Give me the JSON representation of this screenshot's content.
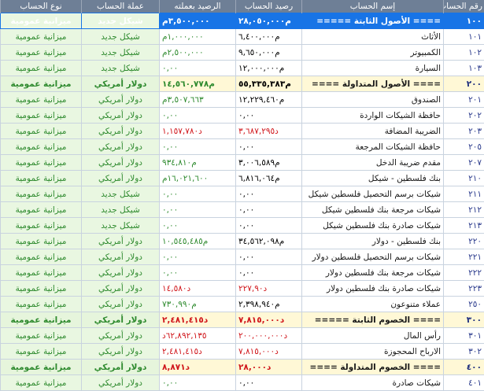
{
  "headers": {
    "code": "رقم الحساب",
    "name": "إسم الحساب",
    "balance": "رصيد الحساب",
    "balance_cur": "الرصيد بعملته",
    "currency": "عملة الحساب",
    "type": "نوع الحساب"
  },
  "rows": [
    {
      "code": "١٠٠",
      "name": "==== الأصول الثابتة =====",
      "balance": "م٢٨,٠٥٠,٠٠٠",
      "balance_cur": "٣,٥٠٠,٠٠٠م",
      "currency": "شيكل جديد",
      "type": "ميزانية عمومية",
      "style": "sel",
      "bal_color": "",
      "cur_color": ""
    },
    {
      "code": "١٠١",
      "name": "الأثاث",
      "balance": "م٦,٤٠٠,٠٠٠",
      "balance_cur": "١,٠٠٠,٠٠٠م",
      "currency": "شيكل جديد",
      "type": "ميزانية عمومية",
      "style": "",
      "bal_color": "",
      "cur_color": "pos"
    },
    {
      "code": "١٠٢",
      "name": "الكمبيوتر",
      "balance": "م٩,٦٥٠,٠٠٠",
      "balance_cur": "٢,٥٠٠,٠٠٠م",
      "currency": "شيكل جديد",
      "type": "ميزانية عمومية",
      "style": "",
      "bal_color": "",
      "cur_color": "pos"
    },
    {
      "code": "١٠٣",
      "name": "السيارة",
      "balance": "م١٢,٠٠٠,٠٠٠",
      "balance_cur": "٠,٠٠",
      "currency": "شيكل جديد",
      "type": "ميزانية عمومية",
      "style": "",
      "bal_color": "",
      "cur_color": "pos"
    },
    {
      "code": "٢٠٠",
      "name": "==== الأصول المتداولة ====",
      "balance": "م٥٥,٣٣٥,٣٨٣",
      "balance_cur": "م١٤,٥٦٠,٧٧٨",
      "currency": "دولار أمريكي",
      "type": "ميزانية عمومية",
      "style": "grp",
      "bal_color": "",
      "cur_color": "pos"
    },
    {
      "code": "٢٠١",
      "name": "الصندوق",
      "balance": "م١٢,٢٢٩,٤٦٠",
      "balance_cur": "٣,٥٠٧,٦٦٣م",
      "currency": "دولار أمريكي",
      "type": "ميزانية عمومية",
      "style": "",
      "bal_color": "",
      "cur_color": "pos"
    },
    {
      "code": "٢٠٢",
      "name": "حافظة الشيكات الواردة",
      "balance": "٠,٠٠",
      "balance_cur": "٠,٠٠",
      "currency": "دولار أمريكي",
      "type": "ميزانية عمومية",
      "style": "",
      "bal_color": "",
      "cur_color": "pos"
    },
    {
      "code": "٢٠٣",
      "name": "الضريبة المضافة",
      "balance": "د٣,٦٨٧,٢٩٥",
      "balance_cur": "د١,١٥٧,٧٨٠",
      "currency": "دولار أمريكي",
      "type": "ميزانية عمومية",
      "style": "",
      "bal_color": "neg",
      "cur_color": "neg"
    },
    {
      "code": "٢٠٥",
      "name": "حافظة الشيكات المرجعة",
      "balance": "٠,٠٠",
      "balance_cur": "٠,٠٠",
      "currency": "دولار أمريكي",
      "type": "ميزانية عمومية",
      "style": "",
      "bal_color": "",
      "cur_color": "pos"
    },
    {
      "code": "٢٠٧",
      "name": "مقدم ضريبة الدخل",
      "balance": "م٣,٠٠٦,٥٨٩",
      "balance_cur": "م٩٣٤,٨١٠",
      "currency": "دولار أمريكي",
      "type": "ميزانية عمومية",
      "style": "",
      "bal_color": "",
      "cur_color": "pos"
    },
    {
      "code": "٢١٠",
      "name": "بنك فلسطين - شيكل",
      "balance": "م٦,٨١٦,٠٦٤",
      "balance_cur": "١٦,٠٢١,٦٠٠م",
      "currency": "دولار أمريكي",
      "type": "ميزانية عمومية",
      "style": "",
      "bal_color": "",
      "cur_color": "pos"
    },
    {
      "code": "٢١١",
      "name": "شيكات برسم التحصيل فلسطين شيكل",
      "balance": "٠,٠٠",
      "balance_cur": "٠,٠٠",
      "currency": "شيكل جديد",
      "type": "ميزانية عمومية",
      "style": "",
      "bal_color": "",
      "cur_color": "pos"
    },
    {
      "code": "٢١٢",
      "name": "شيكات مرجعة بنك فلسطين شيكل",
      "balance": "٠,٠٠",
      "balance_cur": "٠,٠٠",
      "currency": "شيكل جديد",
      "type": "ميزانية عمومية",
      "style": "",
      "bal_color": "",
      "cur_color": "pos"
    },
    {
      "code": "٢١٣",
      "name": "شيكات صادرة بنك فلسطين شيكل",
      "balance": "٠,٠٠",
      "balance_cur": "٠,٠٠",
      "currency": "شيكل جديد",
      "type": "ميزانية عمومية",
      "style": "",
      "bal_color": "",
      "cur_color": "pos"
    },
    {
      "code": "٢٢٠",
      "name": "بنك فلسطين - دولار",
      "balance": "م٣٤,٥٦٢,٠٩٨",
      "balance_cur": "م١٠,٥٤٥,٤٨٥",
      "currency": "دولار أمريكي",
      "type": "ميزانية عمومية",
      "style": "",
      "bal_color": "",
      "cur_color": "pos"
    },
    {
      "code": "٢٢١",
      "name": "شيكات برسم التحصيل فلسطين دولار",
      "balance": "٠,٠٠",
      "balance_cur": "٠,٠٠",
      "currency": "دولار أمريكي",
      "type": "ميزانية عمومية",
      "style": "",
      "bal_color": "",
      "cur_color": "pos"
    },
    {
      "code": "٢٢٢",
      "name": "شيكات مرجعة بنك فلسطين دولار",
      "balance": "٠,٠٠",
      "balance_cur": "٠,٠٠",
      "currency": "دولار أمريكي",
      "type": "ميزانية عمومية",
      "style": "",
      "bal_color": "",
      "cur_color": "pos"
    },
    {
      "code": "٢٢٣",
      "name": "شيكات صادرة بنك فلسطين دولار",
      "balance": "د٢٢٧,٩٠",
      "balance_cur": "د١٤,٥٨٠",
      "currency": "دولار أمريكي",
      "type": "ميزانية عمومية",
      "style": "",
      "bal_color": "neg",
      "cur_color": "neg"
    },
    {
      "code": "٢٥٠",
      "name": "عملاء متنوعون",
      "balance": "م٢,٣٩٨,٩٤٠",
      "balance_cur": "م٧٣٠,٩٩٠",
      "currency": "دولار أمريكي",
      "type": "ميزانية عمومية",
      "style": "",
      "bal_color": "",
      "cur_color": "pos"
    },
    {
      "code": "٣٠٠",
      "name": "==== الخصوم الثابتة =====",
      "balance": "د٧,٨١٥,٠٠٠",
      "balance_cur": "د٢,٤٨١,٤١٥",
      "currency": "دولار أمريكي",
      "type": "ميزانية عمومية",
      "style": "grp",
      "bal_color": "neg",
      "cur_color": "neg"
    },
    {
      "code": "٣٠١",
      "name": "رأس المال",
      "balance": "د٢٠٠,٠٠٠,٠٠٠",
      "balance_cur": "٦٢,٨٩٢,١٣٥د",
      "currency": "دولار أمريكي",
      "type": "ميزانية عمومية",
      "style": "",
      "bal_color": "neg",
      "cur_color": "neg"
    },
    {
      "code": "٣٠٢",
      "name": "الارباح المحجوزة",
      "balance": "د٧,٨١٥,٠٠٠",
      "balance_cur": "د٢,٤٨١,٤١٥",
      "currency": "دولار أمريكي",
      "type": "ميزانية عمومية",
      "style": "",
      "bal_color": "neg",
      "cur_color": "neg"
    },
    {
      "code": "٤٠٠",
      "name": "==== الخصوم المتداولة ====",
      "balance": "د٢٨,٠٠٠",
      "balance_cur": "د٨,٨٧١",
      "currency": "دولار أمريكي",
      "type": "ميزانية عمومية",
      "style": "grp",
      "bal_color": "neg",
      "cur_color": "neg"
    },
    {
      "code": "٤٠١",
      "name": "شيكات صادرة",
      "balance": "٠,٠٠",
      "balance_cur": "٠,٠٠",
      "currency": "دولار أمريكي",
      "type": "ميزانية عمومية",
      "style": "",
      "bal_color": "",
      "cur_color": "pos"
    }
  ],
  "colors": {
    "header_bg": "#6e7f96",
    "selected_bg": "#1874e6",
    "group_bg": "#fff8d6",
    "green_text": "#2e8a2e",
    "red_text": "#d0151a"
  }
}
